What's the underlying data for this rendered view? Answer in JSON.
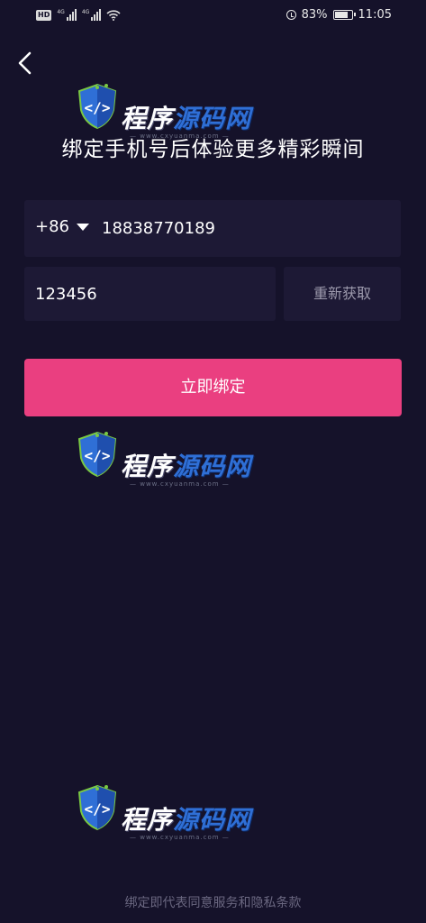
{
  "status_bar": {
    "hd_label": "HD",
    "network_1": "4G",
    "network_2": "4G",
    "battery": "83%",
    "time": "11:05"
  },
  "back_icon": "chevron-left-icon",
  "title": "绑定手机号后体验更多精彩瞬间",
  "phone": {
    "country_code": "+86",
    "value": "18838770189"
  },
  "code": {
    "value": "123456",
    "resend_label": "重新获取"
  },
  "submit_label": "立即绑定",
  "watermark": {
    "text_a": "程序",
    "text_b": "源码网",
    "url": "— www.cxyuanma.com —"
  },
  "footer_text": "绑定即代表同意服务和隐私条款",
  "colors": {
    "background": "#15122a",
    "field": "#1d1935",
    "accent": "#ea3f80"
  }
}
